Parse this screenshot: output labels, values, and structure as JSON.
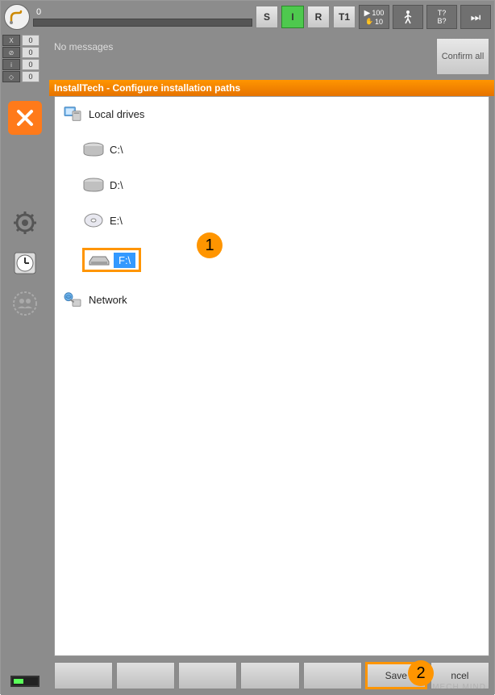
{
  "top": {
    "speed": "0",
    "modes": [
      "S",
      "I",
      "R",
      "T1"
    ],
    "active_mode": 1,
    "rate_top": "100",
    "rate_bottom": "10",
    "t_top": "T?",
    "t_bottom": "B?"
  },
  "status": [
    {
      "icon": "X",
      "val": "0"
    },
    {
      "icon": "⊘",
      "val": "0"
    },
    {
      "icon": "i",
      "val": "0"
    },
    {
      "icon": "◇",
      "val": "0"
    }
  ],
  "messages": {
    "text": "No messages",
    "confirm": "Confirm all"
  },
  "window": {
    "title": "InstallTech - Configure installation paths"
  },
  "tree": {
    "root_local": "Local drives",
    "drives": [
      "C:\\",
      "D:\\",
      "E:\\",
      "F:\\"
    ],
    "selected": "F:\\",
    "root_network": "Network"
  },
  "callouts": {
    "c1": "1",
    "c2": "2"
  },
  "buttons": {
    "save": "Save",
    "cancel": "ncel"
  },
  "watermark": "MECH MIND"
}
